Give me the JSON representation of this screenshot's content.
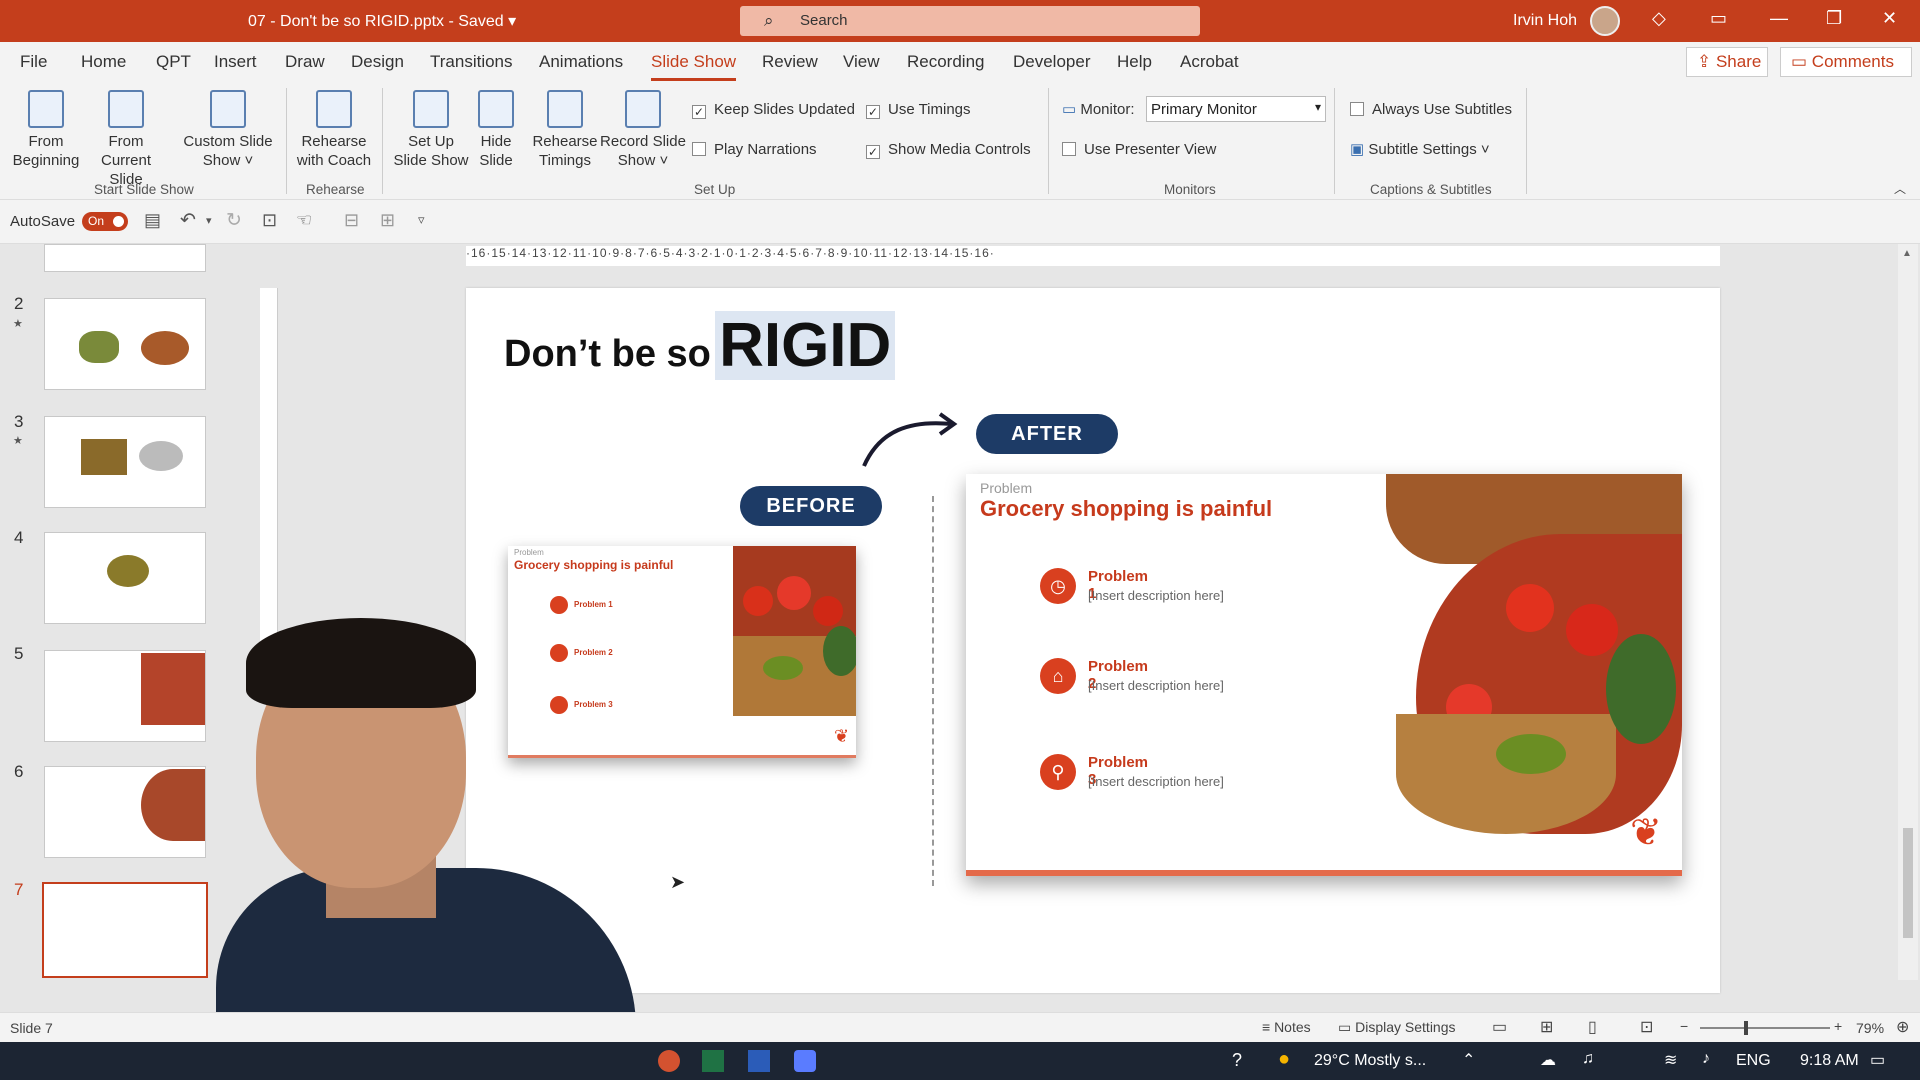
{
  "titlebar": {
    "doc_title": "07 - Don't be so RIGID.pptx - Saved ▾",
    "search_placeholder": "Search",
    "user_name": "Irvin Hoh"
  },
  "tabs": [
    "File",
    "Home",
    "QPT",
    "Insert",
    "Draw",
    "Design",
    "Transitions",
    "Animations",
    "Slide Show",
    "Review",
    "View",
    "Recording",
    "Developer",
    "Help",
    "Acrobat"
  ],
  "share_label": "Share",
  "comments_label": "Comments",
  "ribbon": {
    "from_beginning": "From Beginning",
    "from_current": "From Current Slide",
    "custom_show": "Custom Slide Show ˅",
    "rehearse_coach": "Rehearse with Coach",
    "setup_show": "Set Up Slide Show",
    "hide_slide": "Hide Slide",
    "rehearse_timings": "Rehearse Timings",
    "record_show": "Record Slide Show ˅",
    "keep_updated": "Keep Slides Updated",
    "play_narrations": "Play Narrations",
    "use_timings": "Use Timings",
    "show_media": "Show Media Controls",
    "monitor_label": "Monitor:",
    "monitor_value": "Primary Monitor",
    "presenter_view": "Use Presenter View",
    "always_subtitles": "Always Use Subtitles",
    "subtitle_settings": "Subtitle Settings ˅",
    "groups": {
      "start": "Start Slide Show",
      "rehearse": "Rehearse",
      "setup": "Set Up",
      "monitors": "Monitors",
      "captions": "Captions & Subtitles"
    }
  },
  "qat": {
    "autosave": "AutoSave",
    "toggle": "On"
  },
  "thumbnails": {
    "numbers": [
      "2",
      "3",
      "4",
      "5",
      "6",
      "7"
    ]
  },
  "ruler_text": "·16·15·14·13·12·11·10·9·8·7·6·5·4·3·2·1·0·1·2·3·4·5·6·7·8·9·10·11·12·13·14·15·16·",
  "slide": {
    "title_a": "Don’t be so",
    "title_b": "RIGID",
    "after_label": "AFTER",
    "before_label": "BEFORE",
    "eyebrow": "Problem",
    "heading": "Grocery shopping is painful",
    "problems": [
      {
        "title": "Problem 1",
        "desc": "[Insert description here]"
      },
      {
        "title": "Problem 2",
        "desc": "[Insert description here]"
      },
      {
        "title": "Problem 3",
        "desc": "[Insert description here]"
      }
    ]
  },
  "status": {
    "slide": "Slide 7",
    "notes": "Notes",
    "display": "Display Settings",
    "zoom": "79%"
  },
  "taskbar": {
    "weather": "29°C  Mostly s...",
    "lang": "ENG",
    "time": "9:18 AM"
  }
}
